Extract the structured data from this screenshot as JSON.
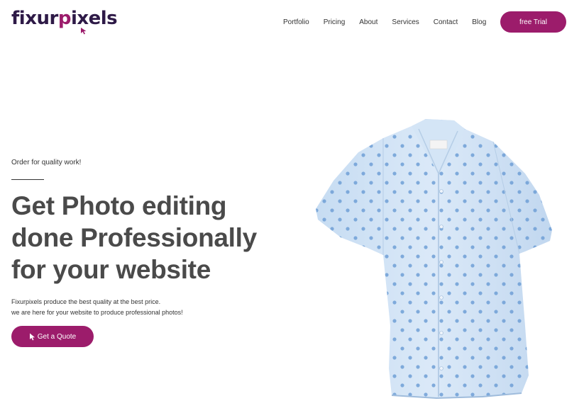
{
  "brand": {
    "logo_part1": "fixur",
    "logo_part2": "p",
    "logo_part3": "ixels",
    "primary_color": "#9c1c6b",
    "dark_color": "#2e1a47"
  },
  "nav": {
    "items": [
      {
        "label": "Portfolio"
      },
      {
        "label": "Pricing"
      },
      {
        "label": "About"
      },
      {
        "label": "Services"
      },
      {
        "label": "Contact"
      },
      {
        "label": "Blog"
      }
    ],
    "cta_label": "free Trial"
  },
  "hero": {
    "eyebrow": "Order for quality work!",
    "headline": [
      "Get Photo editing",
      "done Professionally",
      "for your website"
    ],
    "subtext": [
      "Fixurpixels produce the best quality at the best price.",
      "we are here for your website to produce professional photos!"
    ],
    "cta_label": "Get a Quote",
    "cta_icon": "cursor-icon",
    "image": "shirt-product-image"
  }
}
